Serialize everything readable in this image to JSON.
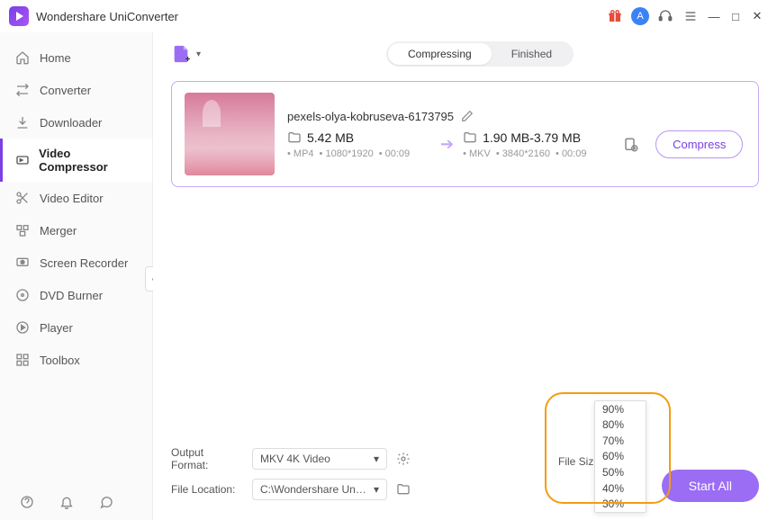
{
  "app": {
    "title": "Wondershare UniConverter"
  },
  "sidebar": {
    "items": [
      {
        "label": "Home"
      },
      {
        "label": "Converter"
      },
      {
        "label": "Downloader"
      },
      {
        "label": "Video Compressor"
      },
      {
        "label": "Video Editor"
      },
      {
        "label": "Merger"
      },
      {
        "label": "Screen Recorder"
      },
      {
        "label": "DVD Burner"
      },
      {
        "label": "Player"
      },
      {
        "label": "Toolbox"
      }
    ]
  },
  "tabs": {
    "compressing": "Compressing",
    "finished": "Finished"
  },
  "file": {
    "name": "pexels-olya-kobruseva-6173795",
    "source": {
      "size": "5.42 MB",
      "format": "MP4",
      "resolution": "1080*1920",
      "duration": "00:09"
    },
    "target": {
      "size": "1.90 MB-3.79 MB",
      "format": "MKV",
      "resolution": "3840*2160",
      "duration": "00:09"
    },
    "compress_label": "Compress"
  },
  "bottom": {
    "output_format_label": "Output Format:",
    "output_format_value": "MKV 4K Video",
    "file_location_label": "File Location:",
    "file_location_value": "C:\\Wondershare UniConverter",
    "file_size_label": "File Size:",
    "start_label": "Start All"
  },
  "filesize_options": [
    "90%",
    "80%",
    "70%",
    "60%",
    "50%",
    "40%",
    "30%"
  ]
}
